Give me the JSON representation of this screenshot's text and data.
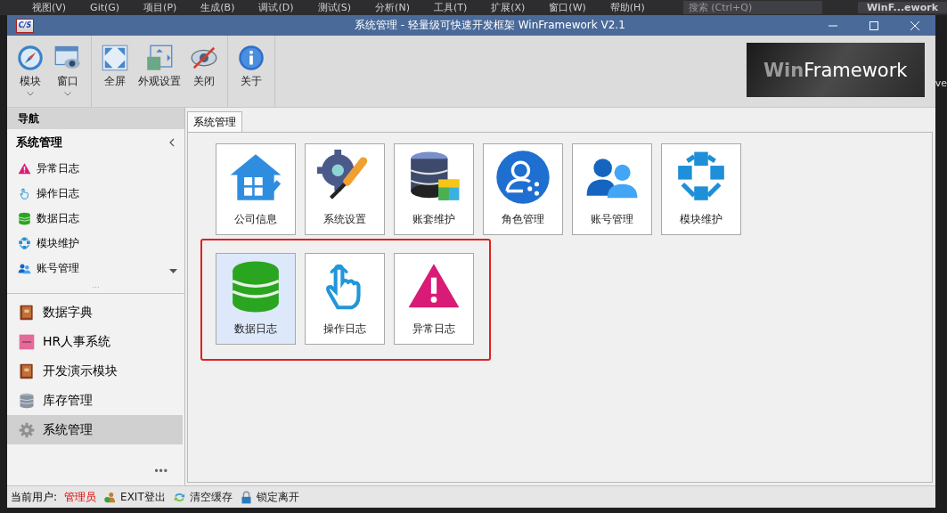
{
  "background_app": {
    "menu": [
      "视图(V)",
      "Git(G)",
      "项目(P)",
      "生成(B)",
      "调试(D)",
      "测试(S)",
      "分析(N)",
      "工具(T)",
      "扩展(X)",
      "窗口(W)",
      "帮助(H)"
    ],
    "search": {
      "placeholder": "搜索 (Ctrl+Q)"
    },
    "title": "WinF...ework",
    "side_text": "ve"
  },
  "window": {
    "app_icon": "C/S",
    "title": "系统管理 - 轻量级可快速开发框架 WinFramework V2.1"
  },
  "toolbar": {
    "groups": [
      [
        {
          "label": "模块",
          "kind": "compass",
          "dropdown": true
        },
        {
          "label": "窗口",
          "kind": "window-eye",
          "dropdown": true
        }
      ],
      [
        {
          "label": "全屏",
          "kind": "fullscreen",
          "dropdown": false
        },
        {
          "label": "外观设置",
          "kind": "layout",
          "dropdown": false
        },
        {
          "label": "关闭",
          "kind": "eye-off",
          "dropdown": false
        }
      ],
      [
        {
          "label": "关于",
          "kind": "info",
          "dropdown": false
        }
      ]
    ],
    "logo": {
      "bold": "Win",
      "rest": "Framework"
    }
  },
  "sidebar": {
    "header": "导航",
    "group": {
      "title": "系统管理",
      "expanded": true,
      "items": [
        {
          "label": "异常日志",
          "kind": "warning"
        },
        {
          "label": "操作日志",
          "kind": "hand"
        },
        {
          "label": "数据日志",
          "kind": "database"
        },
        {
          "label": "模块维护",
          "kind": "cubes"
        },
        {
          "label": "账号管理",
          "kind": "users"
        }
      ]
    },
    "grip": "...",
    "modules": [
      {
        "label": "数据字典",
        "kind": "book",
        "selected": false
      },
      {
        "label": "HR人事系统",
        "kind": "hr",
        "selected": false
      },
      {
        "label": "开发演示模块",
        "kind": "book",
        "selected": false
      },
      {
        "label": "库存管理",
        "kind": "stack",
        "selected": false
      },
      {
        "label": "系统管理",
        "kind": "gear",
        "selected": true
      }
    ],
    "more": "•••"
  },
  "tabs": [
    {
      "label": "系统管理",
      "selected": true
    }
  ],
  "tile_rows": [
    {
      "highlighted": false,
      "tiles": [
        {
          "label": "公司信息",
          "kind": "house",
          "selected": false
        },
        {
          "label": "系统设置",
          "kind": "gear-wrench",
          "selected": false
        },
        {
          "label": "账套维护",
          "kind": "database-cube",
          "selected": false
        },
        {
          "label": "角色管理",
          "kind": "role",
          "selected": false
        },
        {
          "label": "账号管理",
          "kind": "users",
          "selected": false
        },
        {
          "label": "模块维护",
          "kind": "cubes",
          "selected": false
        }
      ]
    },
    {
      "highlighted": true,
      "tiles": [
        {
          "label": "数据日志",
          "kind": "database",
          "selected": true
        },
        {
          "label": "操作日志",
          "kind": "hand",
          "selected": false
        },
        {
          "label": "异常日志",
          "kind": "warning",
          "selected": false
        }
      ]
    }
  ],
  "status_bar": {
    "user_label": "当前用户:",
    "user": "管理员",
    "actions": [
      {
        "label": "EXIT登出",
        "kind": "user-exit"
      },
      {
        "label": "清空缓存",
        "kind": "refresh"
      },
      {
        "label": "锁定离开",
        "kind": "lock"
      }
    ]
  }
}
